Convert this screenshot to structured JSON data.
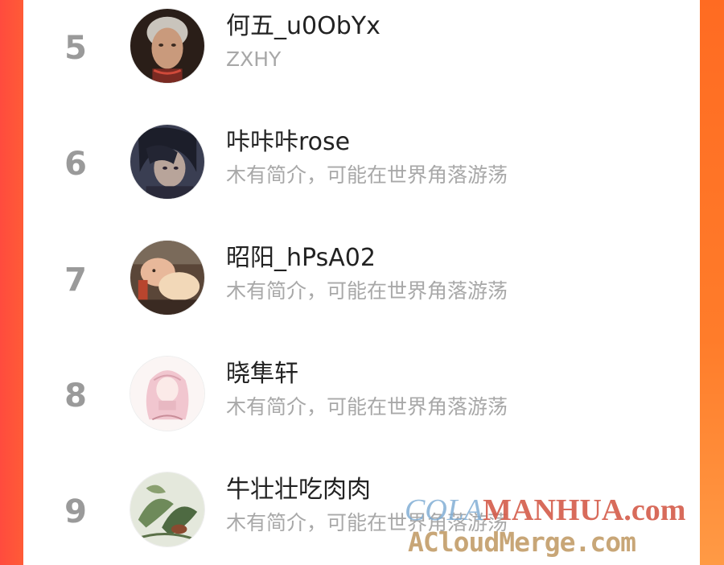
{
  "leaderboard": {
    "rows": [
      {
        "rank": "5",
        "name": "何五_u0ObYx",
        "bio": "ZXHY",
        "avatar": "avatar-silver-hair-man"
      },
      {
        "rank": "6",
        "name": "咔咔咔rose",
        "bio": "木有简介，可能在世界角落游荡",
        "avatar": "avatar-dark-hair-man"
      },
      {
        "rank": "7",
        "name": "昭阳_hPsA02",
        "bio": "木有简介，可能在世界角落游荡",
        "avatar": "avatar-person-with-cat"
      },
      {
        "rank": "8",
        "name": "晓隼轩",
        "bio": "木有简介，可能在世界角落游荡",
        "avatar": "avatar-pink-sketch-girl"
      },
      {
        "rank": "9",
        "name": "牛壮壮吃肉肉",
        "bio": "木有简介，可能在世界角落游荡",
        "avatar": "avatar-green-foliage"
      }
    ]
  },
  "watermarks": {
    "line1_prefix": "COLA",
    "line1_main": "MANHUA.com",
    "line2": "ACloudMerge.com"
  },
  "colors": {
    "background_left": "#ff4b3e",
    "background_right": "#ff7c2a",
    "rank": "#9a9a9a",
    "name": "#222222",
    "bio": "#a8a8a8"
  }
}
